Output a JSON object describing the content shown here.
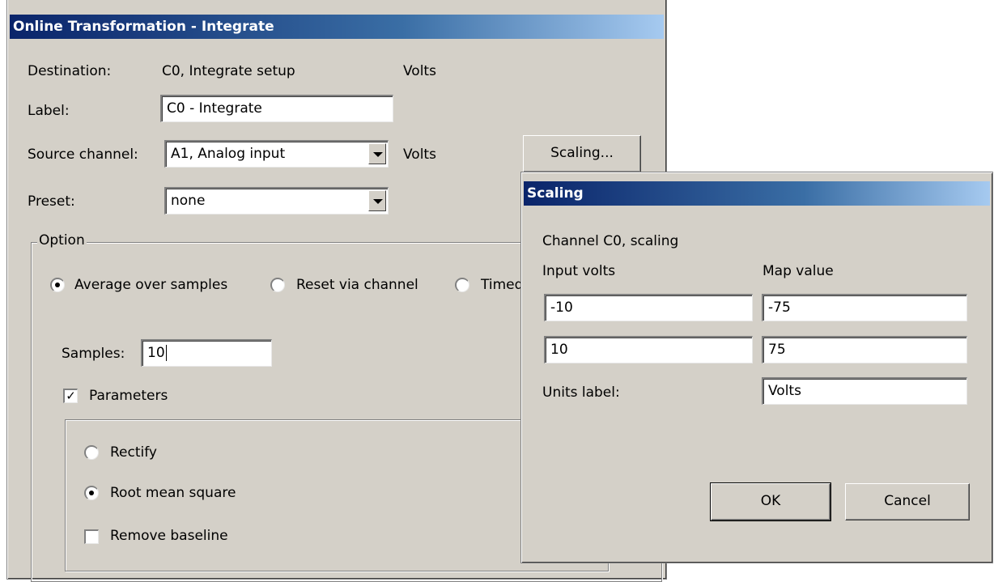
{
  "main": {
    "title": "Online Transformation - Integrate",
    "destination_label": "Destination:",
    "destination_value": "C0, Integrate setup",
    "destination_units": "Volts",
    "label_label": "Label:",
    "label_value": "C0 - Integrate",
    "source_label": "Source channel:",
    "source_value": "A1, Analog input",
    "source_units": "Volts",
    "scaling_button": "Scaling...",
    "preset_label": "Preset:",
    "preset_value": "none",
    "option_group": "Option",
    "radio_average": "Average over samples",
    "radio_reset": "Reset via channel",
    "radio_timed": "Timed",
    "samples_label": "Samples:",
    "samples_value": "10",
    "parameters_label": "Parameters",
    "parameters_checked": true,
    "rectify_label": "Rectify",
    "rms_label": "Root mean square",
    "remove_baseline_label": "Remove baseline",
    "remove_baseline_checked": false
  },
  "scaling": {
    "title": "Scaling",
    "subtitle": "Channel C0, scaling",
    "input_volts_header": "Input volts",
    "map_value_header": "Map value",
    "rows": [
      {
        "input": "-10",
        "map": "-75"
      },
      {
        "input": "10",
        "map": "75"
      }
    ],
    "units_label": "Units label:",
    "units_value": "Volts",
    "ok_button": "OK",
    "cancel_button": "Cancel"
  }
}
